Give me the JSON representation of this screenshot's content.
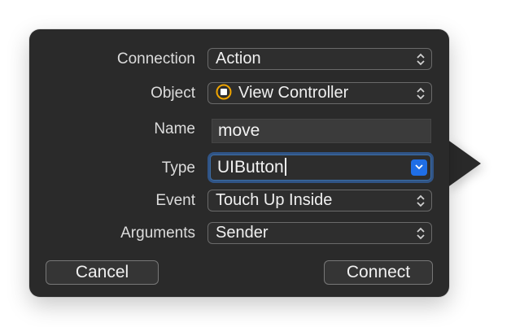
{
  "connection": {
    "label": "Connection",
    "value": "Action"
  },
  "object": {
    "label": "Object",
    "value": "View Controller",
    "icon": "view-controller-icon"
  },
  "name": {
    "label": "Name",
    "value": "move"
  },
  "type": {
    "label": "Type",
    "value": "UIButton"
  },
  "event": {
    "label": "Event",
    "value": "Touch Up Inside"
  },
  "arguments": {
    "label": "Arguments",
    "value": "Sender"
  },
  "buttons": {
    "cancel": "Cancel",
    "connect": "Connect"
  },
  "colors": {
    "panel": "#2a2a2a",
    "accent": "#1f6ee6",
    "object_icon": "#f0a500"
  }
}
